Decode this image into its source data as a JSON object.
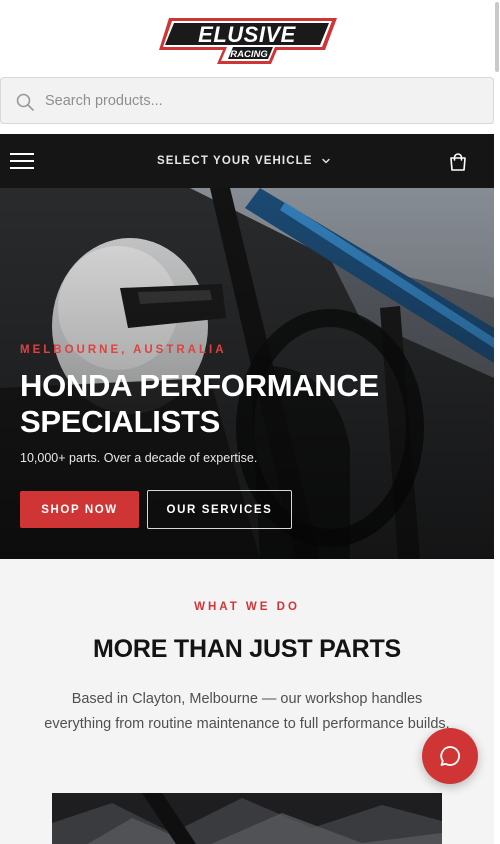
{
  "brand": {
    "logo_text_top": "ELUSIVE",
    "logo_text_bottom": "RACING",
    "logo_color": "#1a1a1a",
    "accent": "#d03536"
  },
  "search": {
    "placeholder": "Search products...",
    "value": "",
    "icon": "search-icon"
  },
  "nav": {
    "menu_icon": "hamburger-icon",
    "vehicle_label": "SELECT YOUR VEHICLE",
    "vehicle_chevron": "chevron-down-icon",
    "cart_icon": "cart-icon",
    "background": "#151515"
  },
  "hero": {
    "eyebrow": "MELBOURNE, AUSTRALIA",
    "title": "HONDA PERFORMANCE SPECIALISTS",
    "subtitle": "10,000+ parts. Over a decade of expertise.",
    "primary_button": "SHOP NOW",
    "secondary_button": "OUR SERVICES"
  },
  "what_we_do": {
    "eyebrow": "WHAT WE DO",
    "title": "MORE THAN JUST PARTS",
    "body": "Based in Clayton, Melbourne — our workshop handles everything from routine maintenance to full performance builds."
  },
  "chat": {
    "icon": "chat-bubble-icon"
  }
}
